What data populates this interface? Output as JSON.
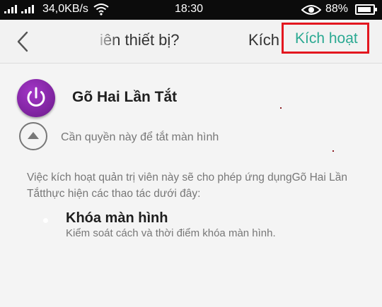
{
  "status_bar": {
    "network_speed": "34,0KB/s",
    "time": "18:30",
    "battery_percent": "88%",
    "battery_level": 0.88
  },
  "header": {
    "title_fragment": "iên thiết bị?",
    "faded_action": "Kích",
    "activate_label": "Kích hoạt",
    "highlight_color": "#e3171f",
    "accent_color": "#2ba992"
  },
  "app": {
    "name": "Gõ Hai Lần Tắt",
    "icon": "power-icon",
    "icon_color": "#8e2bb0"
  },
  "permission_hint": "Cần quyền này để tắt màn hình",
  "description": "Việc kích hoạt quản trị viên này sẽ cho phép ứng dụngGõ Hai Lần Tắtthực hiện các thao tác dưới đây:",
  "permissions": [
    {
      "title": "Khóa màn hình",
      "description": "Kiểm soát cách và thời điểm khóa màn hình."
    }
  ]
}
